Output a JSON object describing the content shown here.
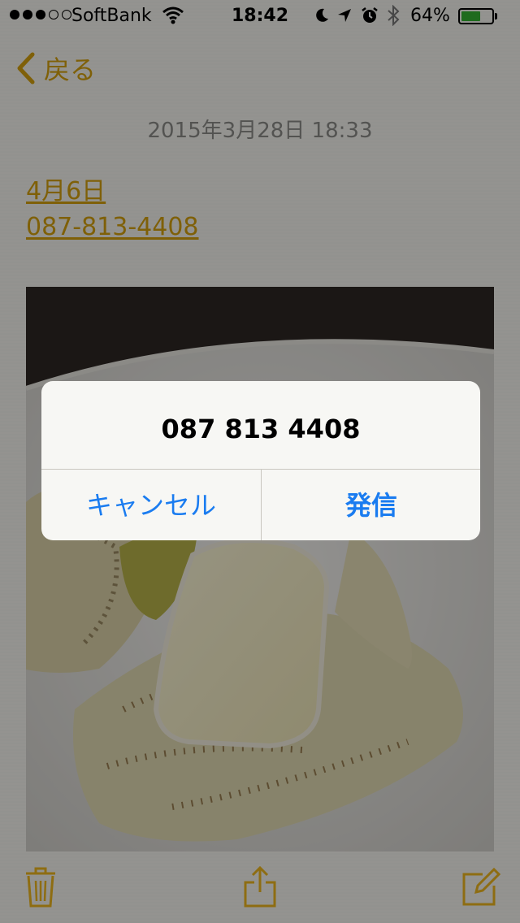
{
  "status_bar": {
    "carrier": "SoftBank",
    "time": "18:42",
    "battery_percent": "64%",
    "battery_level": 0.64,
    "signal_filled": 3,
    "signal_total": 5
  },
  "nav": {
    "back_label": "戻る"
  },
  "note": {
    "date": "2015年3月28日 18:33",
    "links": [
      "4月6日",
      "087-813-4408"
    ]
  },
  "alert": {
    "title": "087 813 4408",
    "cancel_label": "キャンセル",
    "call_label": "発信"
  },
  "toolbar": {
    "icons": [
      "trash-icon",
      "share-icon",
      "compose-icon"
    ]
  },
  "colors": {
    "accent": "#d4a00e",
    "alert_button": "#1a7cf0",
    "battery": "#34b233"
  }
}
